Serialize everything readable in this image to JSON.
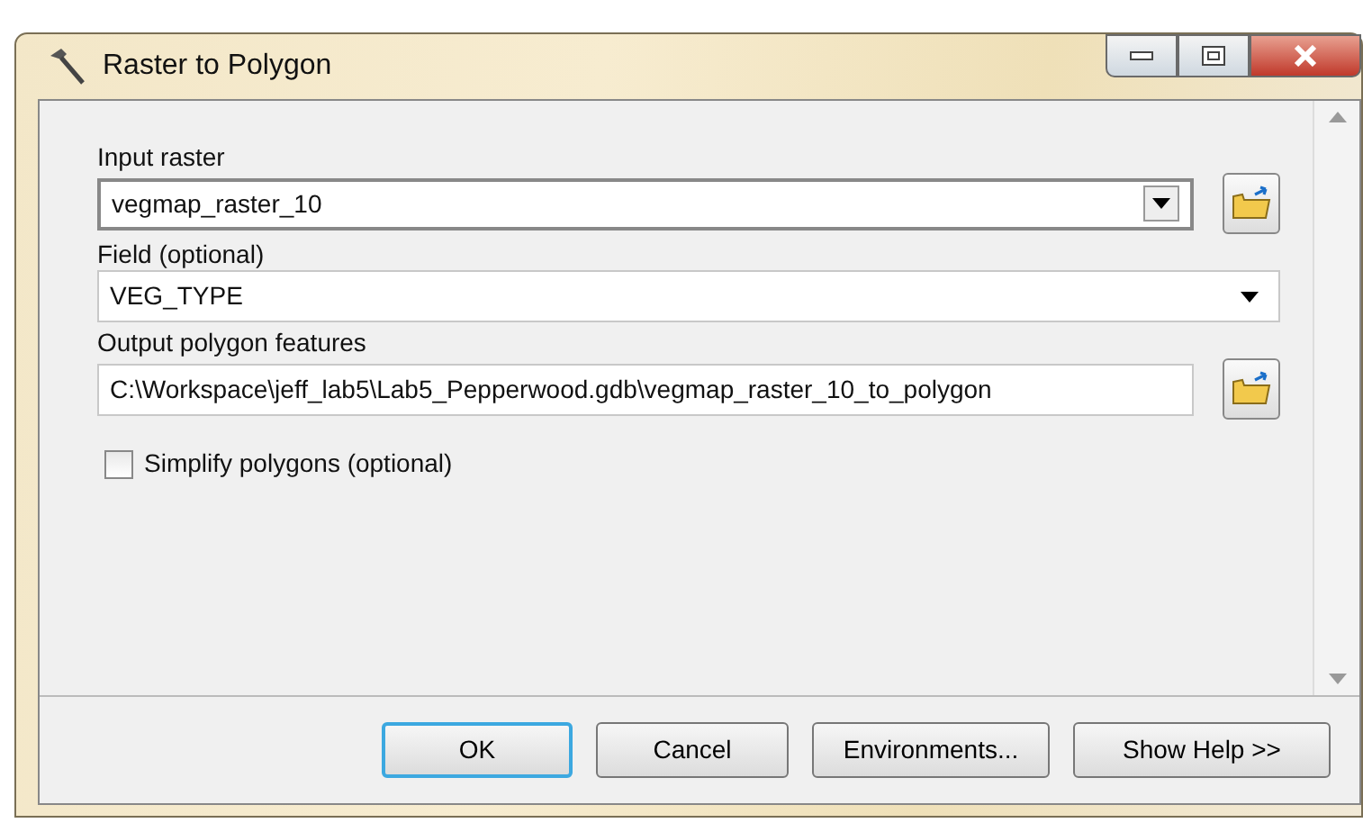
{
  "window": {
    "title": "Raster to Polygon"
  },
  "fields": [
    {
      "kind": "combo",
      "label": "Input raster",
      "value": "vegmap_raster_10",
      "browse": true
    },
    {
      "kind": "select",
      "label": "Field (optional)",
      "value": "VEG_TYPE",
      "browse": false
    },
    {
      "kind": "text",
      "label": "Output polygon features",
      "value": "C:\\Workspace\\jeff_lab5\\Lab5_Pepperwood.gdb\\vegmap_raster_10_to_polygon",
      "browse": true
    }
  ],
  "options": [
    {
      "label": "Simplify polygons (optional)",
      "checked": false
    }
  ],
  "buttons": [
    {
      "label": "OK",
      "default": true
    },
    {
      "label": "Cancel",
      "default": false
    },
    {
      "label": "Environments...",
      "default": false
    },
    {
      "label": "Show Help >>",
      "default": false
    }
  ]
}
